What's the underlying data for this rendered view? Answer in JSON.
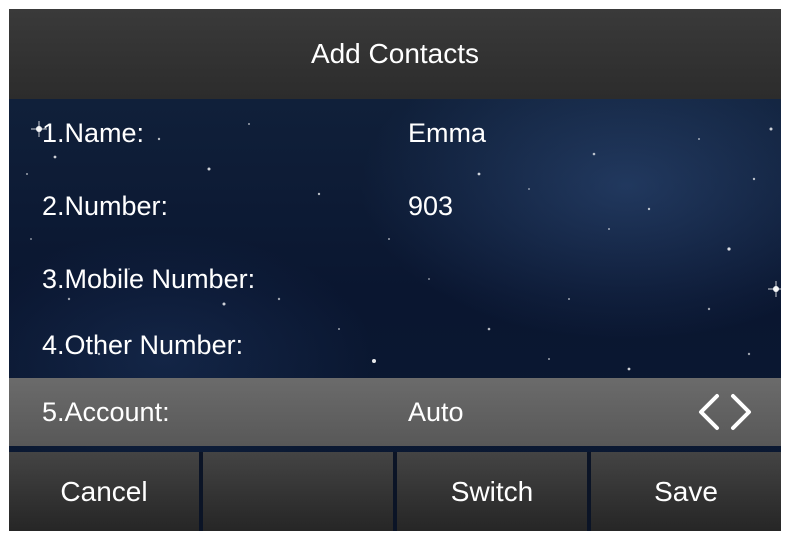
{
  "title": "Add Contacts",
  "fields": [
    {
      "label": "1.Name:",
      "value": "Emma"
    },
    {
      "label": "2.Number:",
      "value": "903"
    },
    {
      "label": "3.Mobile Number:",
      "value": ""
    },
    {
      "label": "4.Other Number:",
      "value": ""
    },
    {
      "label": "5.Account:",
      "value": "Auto"
    }
  ],
  "selected_field_index": 4,
  "selector_icons": [
    "chevron-left-icon",
    "chevron-right-icon"
  ],
  "softkeys": {
    "key1": "Cancel",
    "key2": "",
    "key3": "Switch",
    "key4": "Save"
  },
  "colors": {
    "title_bar": "#2c2c2c",
    "selected_row": "#5f5f5f",
    "softkey": "#333333",
    "text": "#ffffff"
  }
}
